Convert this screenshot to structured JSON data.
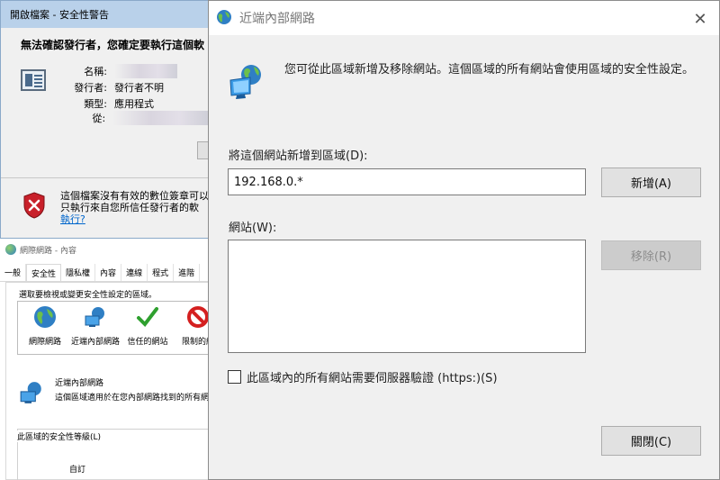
{
  "security_warning": {
    "title": "開啟檔案 - 安全性警告",
    "question": "無法確認發行者，您確定要執行這個軟",
    "fields": [
      {
        "label": "名稱:",
        "value": ""
      },
      {
        "label": "發行者:",
        "value": "發行者不明"
      },
      {
        "label": "類型:",
        "value": "應用程式"
      },
      {
        "label": "從:",
        "value": ""
      }
    ],
    "warning_text_line1": "這個檔案沒有有效的數位簽章可以",
    "warning_text_line2": "只執行來自您所信任發行者的軟",
    "warning_link": "執行?"
  },
  "internet_properties": {
    "title": "網際網路 - 內容",
    "tabs": [
      "一般",
      "安全性",
      "隱私權",
      "內容",
      "連線",
      "程式",
      "進階"
    ],
    "selected_tab": "安全性",
    "prompt": "選取要檢視或變更安全性設定的區域。",
    "zones": [
      {
        "name": "網際網路",
        "icon": "globe-icon"
      },
      {
        "name": "近端內部網路",
        "icon": "intranet-icon"
      },
      {
        "name": "信任的網站",
        "icon": "checkmark-icon"
      },
      {
        "name": "限制的網",
        "icon": "restricted-icon"
      }
    ],
    "selected_zone_title": "近端內部網路",
    "selected_zone_desc": "這個區域適用於在您內部網路找到的所有網",
    "security_level_label": "此區域的安全性等級(L)",
    "security_level_value": "自訂"
  },
  "dialog": {
    "title": "近端內部網路",
    "description": "您可從此區域新增及移除網站。這個區域的所有網站會使用區域的安全性設定。",
    "add_label": "將這個網站新增到區域(D):",
    "add_input_value": "192.168.0.*",
    "add_button": "新增(A)",
    "sites_label": "網站(W):",
    "sites": [],
    "remove_button": "移除(R)",
    "https_checkbox_label": "此區域內的所有網站需要伺服器驗證 (https:)(S)",
    "https_checked": false,
    "close_button": "關閉(C)",
    "close_icon": "✕"
  }
}
